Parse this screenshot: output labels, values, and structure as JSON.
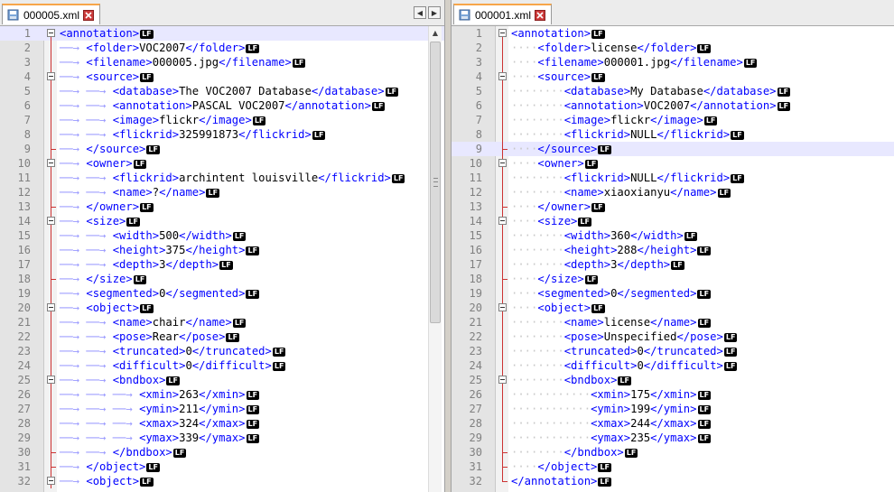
{
  "left": {
    "tab": {
      "title": "000005.xml",
      "active": true
    },
    "highlight_line": 1,
    "lines": [
      {
        "n": "1",
        "d": 0,
        "o": "<",
        "t": "annotation",
        "c": null
      },
      {
        "n": "2",
        "d": 1,
        "o": "<",
        "t": "folder",
        "c": "VOC2007"
      },
      {
        "n": "3",
        "d": 1,
        "o": "<",
        "t": "filename",
        "c": "000005.jpg"
      },
      {
        "n": "4",
        "d": 1,
        "o": "<",
        "t": "source",
        "c": null
      },
      {
        "n": "5",
        "d": 2,
        "o": "<",
        "t": "database",
        "c": "The VOC2007 Database",
        "cut": true
      },
      {
        "n": "6",
        "d": 2,
        "o": "<",
        "t": "annotation",
        "c": "PASCAL VOC2007"
      },
      {
        "n": "7",
        "d": 2,
        "o": "<",
        "t": "image",
        "c": "flickr"
      },
      {
        "n": "8",
        "d": 2,
        "o": "<",
        "t": "flickrid",
        "c": "325991873"
      },
      {
        "n": "9",
        "d": 1,
        "o": "</",
        "t": "source",
        "c": null
      },
      {
        "n": "10",
        "d": 1,
        "o": "<",
        "t": "owner",
        "c": null
      },
      {
        "n": "11",
        "d": 2,
        "o": "<",
        "t": "flickrid",
        "c": "archintent louisville",
        "cut": true
      },
      {
        "n": "12",
        "d": 2,
        "o": "<",
        "t": "name",
        "c": "?"
      },
      {
        "n": "13",
        "d": 1,
        "o": "</",
        "t": "owner",
        "c": null
      },
      {
        "n": "14",
        "d": 1,
        "o": "<",
        "t": "size",
        "c": null
      },
      {
        "n": "15",
        "d": 2,
        "o": "<",
        "t": "width",
        "c": "500"
      },
      {
        "n": "16",
        "d": 2,
        "o": "<",
        "t": "height",
        "c": "375"
      },
      {
        "n": "17",
        "d": 2,
        "o": "<",
        "t": "depth",
        "c": "3"
      },
      {
        "n": "18",
        "d": 1,
        "o": "</",
        "t": "size",
        "c": null
      },
      {
        "n": "19",
        "d": 1,
        "o": "<",
        "t": "segmented",
        "c": "0"
      },
      {
        "n": "20",
        "d": 1,
        "o": "<",
        "t": "object",
        "c": null
      },
      {
        "n": "21",
        "d": 2,
        "o": "<",
        "t": "name",
        "c": "chair"
      },
      {
        "n": "22",
        "d": 2,
        "o": "<",
        "t": "pose",
        "c": "Rear"
      },
      {
        "n": "23",
        "d": 2,
        "o": "<",
        "t": "truncated",
        "c": "0"
      },
      {
        "n": "24",
        "d": 2,
        "o": "<",
        "t": "difficult",
        "c": "0"
      },
      {
        "n": "25",
        "d": 2,
        "o": "<",
        "t": "bndbox",
        "c": null
      },
      {
        "n": "26",
        "d": 3,
        "o": "<",
        "t": "xmin",
        "c": "263"
      },
      {
        "n": "27",
        "d": 3,
        "o": "<",
        "t": "ymin",
        "c": "211"
      },
      {
        "n": "28",
        "d": 3,
        "o": "<",
        "t": "xmax",
        "c": "324"
      },
      {
        "n": "29",
        "d": 3,
        "o": "<",
        "t": "ymax",
        "c": "339"
      },
      {
        "n": "30",
        "d": 2,
        "o": "</",
        "t": "bndbox",
        "c": null
      },
      {
        "n": "31",
        "d": 1,
        "o": "</",
        "t": "object",
        "c": null
      },
      {
        "n": "32",
        "d": 1,
        "o": "<",
        "t": "object",
        "c": null
      }
    ]
  },
  "right": {
    "tab": {
      "title": "000001.xml",
      "active": true
    },
    "highlight_line": 9,
    "lines": [
      {
        "n": "1",
        "d": 0,
        "o": "<",
        "t": "annotation",
        "c": null
      },
      {
        "n": "2",
        "d": 1,
        "o": "<",
        "t": "folder",
        "c": "license"
      },
      {
        "n": "3",
        "d": 1,
        "o": "<",
        "t": "filename",
        "c": "000001.jpg"
      },
      {
        "n": "4",
        "d": 1,
        "o": "<",
        "t": "source",
        "c": null
      },
      {
        "n": "5",
        "d": 2,
        "o": "<",
        "t": "database",
        "c": "My Database"
      },
      {
        "n": "6",
        "d": 2,
        "o": "<",
        "t": "annotation",
        "c": "VOC2007"
      },
      {
        "n": "7",
        "d": 2,
        "o": "<",
        "t": "image",
        "c": "flickr"
      },
      {
        "n": "8",
        "d": 2,
        "o": "<",
        "t": "flickrid",
        "c": "NULL"
      },
      {
        "n": "9",
        "d": 1,
        "o": "</",
        "t": "source",
        "c": null
      },
      {
        "n": "10",
        "d": 1,
        "o": "<",
        "t": "owner",
        "c": null
      },
      {
        "n": "11",
        "d": 2,
        "o": "<",
        "t": "flickrid",
        "c": "NULL"
      },
      {
        "n": "12",
        "d": 2,
        "o": "<",
        "t": "name",
        "c": "xiaoxianyu"
      },
      {
        "n": "13",
        "d": 1,
        "o": "</",
        "t": "owner",
        "c": null
      },
      {
        "n": "14",
        "d": 1,
        "o": "<",
        "t": "size",
        "c": null
      },
      {
        "n": "15",
        "d": 2,
        "o": "<",
        "t": "width",
        "c": "360"
      },
      {
        "n": "16",
        "d": 2,
        "o": "<",
        "t": "height",
        "c": "288"
      },
      {
        "n": "17",
        "d": 2,
        "o": "<",
        "t": "depth",
        "c": "3"
      },
      {
        "n": "18",
        "d": 1,
        "o": "</",
        "t": "size",
        "c": null
      },
      {
        "n": "19",
        "d": 1,
        "o": "<",
        "t": "segmented",
        "c": "0"
      },
      {
        "n": "20",
        "d": 1,
        "o": "<",
        "t": "object",
        "c": null
      },
      {
        "n": "21",
        "d": 2,
        "o": "<",
        "t": "name",
        "c": "license"
      },
      {
        "n": "22",
        "d": 2,
        "o": "<",
        "t": "pose",
        "c": "Unspecified"
      },
      {
        "n": "23",
        "d": 2,
        "o": "<",
        "t": "truncated",
        "c": "0"
      },
      {
        "n": "24",
        "d": 2,
        "o": "<",
        "t": "difficult",
        "c": "0"
      },
      {
        "n": "25",
        "d": 2,
        "o": "<",
        "t": "bndbox",
        "c": null
      },
      {
        "n": "26",
        "d": 3,
        "o": "<",
        "t": "xmin",
        "c": "175"
      },
      {
        "n": "27",
        "d": 3,
        "o": "<",
        "t": "ymin",
        "c": "199"
      },
      {
        "n": "28",
        "d": 3,
        "o": "<",
        "t": "xmax",
        "c": "244"
      },
      {
        "n": "29",
        "d": 3,
        "o": "<",
        "t": "ymax",
        "c": "235"
      },
      {
        "n": "30",
        "d": 2,
        "o": "</",
        "t": "bndbox",
        "c": null
      },
      {
        "n": "31",
        "d": 1,
        "o": "</",
        "t": "object",
        "c": null
      },
      {
        "n": "32",
        "d": 0,
        "o": "</",
        "t": "annotation",
        "c": null
      }
    ]
  },
  "eol_marker": "LF",
  "nav": {
    "prev_glyph": "◀",
    "next_glyph": "▶",
    "scroll_up_glyph": "▲"
  }
}
